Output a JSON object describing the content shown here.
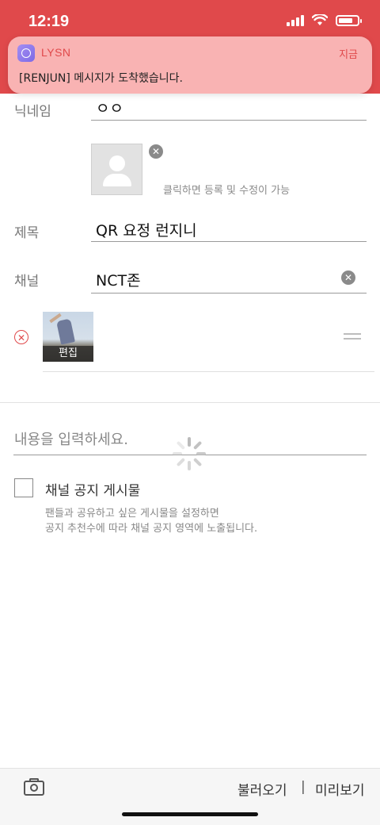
{
  "status": {
    "time": "12:19"
  },
  "notification": {
    "app": "LYSN",
    "time": "지금",
    "message": "[RENJUN] 메시지가 도착했습니다."
  },
  "form": {
    "nickname_label": "닉네임",
    "nickname_value": "ㅇㅇ",
    "photo_hint": "클릭하면 등록 및 수정이 가능",
    "title_label": "제목",
    "title_value": "QR 요정 런지니",
    "channel_label": "채널",
    "channel_value": "NCT존",
    "attachment_edit_label": "편집",
    "content_placeholder": "내용을 입력하세요.",
    "notice_checkbox_label": "채널 공지 게시물",
    "notice_desc_line1": "팬들과 공유하고 싶은 게시물을 설정하면",
    "notice_desc_line2": "공지 추천수에 따라 채널 공지 영역에 노출됩니다."
  },
  "bottom_bar": {
    "load_label": "불러오기",
    "separator": "|",
    "preview_label": "미리보기"
  },
  "icons": {
    "camera": "camera-icon",
    "spinner": "loading-spinner-icon",
    "drag": "drag-handle-icon",
    "remove": "remove-icon",
    "clear": "clear-icon"
  },
  "colors": {
    "accent": "#e0494b",
    "notification_bg": "#f9b3b3"
  }
}
